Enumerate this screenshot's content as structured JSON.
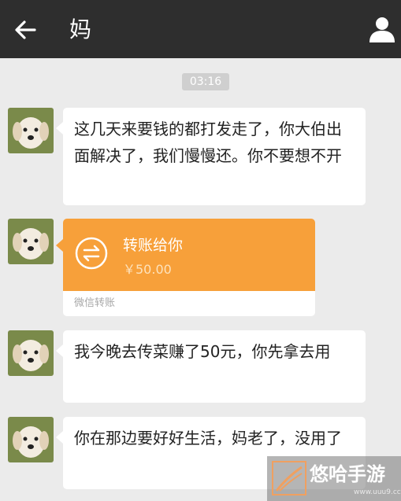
{
  "header": {
    "contact_name": "妈",
    "back_icon": "arrow-left-icon",
    "profile_icon": "person-icon"
  },
  "timestamp": "03:16",
  "messages": [
    {
      "type": "text",
      "text": "这几天来要钱的都打发走了，你大伯出面解决了，我们慢慢还。你不要想不开"
    },
    {
      "type": "transfer",
      "title": "转账给你",
      "amount": "￥50.00",
      "source": "微信转账"
    },
    {
      "type": "text",
      "text": "我今晚去传菜赚了50元，你先拿去用"
    },
    {
      "type": "text",
      "text": "你在那边要好好生活，妈老了，没用了"
    }
  ],
  "watermark": {
    "text": "悠哈手游",
    "url": "www.uuu9.cc"
  },
  "colors": {
    "header_bg": "#2e2e2e",
    "chat_bg": "#ebebeb",
    "transfer_orange": "#f7a03a",
    "bubble_white": "#ffffff"
  }
}
